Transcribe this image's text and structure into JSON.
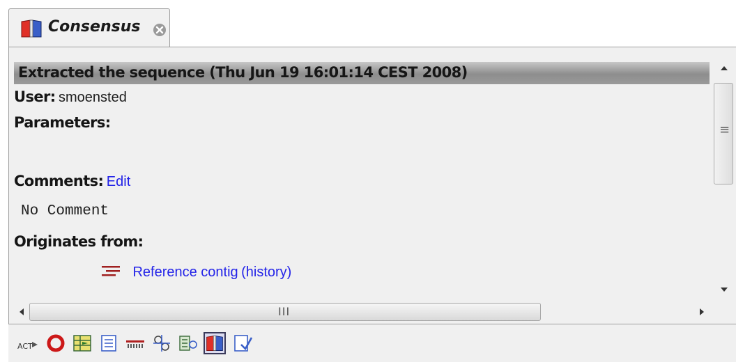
{
  "tab": {
    "title": "Consensus",
    "icon": "book-icon",
    "close_icon": "close-icon"
  },
  "history": {
    "header": "Extracted the sequence (Thu Jun 19 16:01:14 CEST 2008)",
    "user_label": "User:",
    "user_value": "smoensted",
    "parameters_label": "Parameters:",
    "comments_label": "Comments:",
    "comments_edit_link": "Edit",
    "comment_text": "No Comment",
    "originates_label": "Originates from:",
    "origin_link": "Reference contig",
    "origin_history_link": "(history)",
    "origin_icon": "contig-icon"
  },
  "scrollbars": {
    "horizontal_grip": "III",
    "vertical_grip": "≡"
  },
  "toolbar": {
    "buttons": [
      {
        "name": "act-view-icon",
        "text": "ACT"
      },
      {
        "name": "circular-view-icon"
      },
      {
        "name": "table-view-icon"
      },
      {
        "name": "text-view-icon"
      },
      {
        "name": "annotation-table-icon"
      },
      {
        "name": "restriction-sites-icon"
      },
      {
        "name": "element-info-icon"
      },
      {
        "name": "history-icon",
        "active": true
      },
      {
        "name": "edit-info-icon"
      }
    ]
  },
  "colors": {
    "link": "#2323e8",
    "header_bar": "#9a9a9a",
    "panel_bg": "#f0f0f0",
    "contig_icon": "#a02020"
  }
}
